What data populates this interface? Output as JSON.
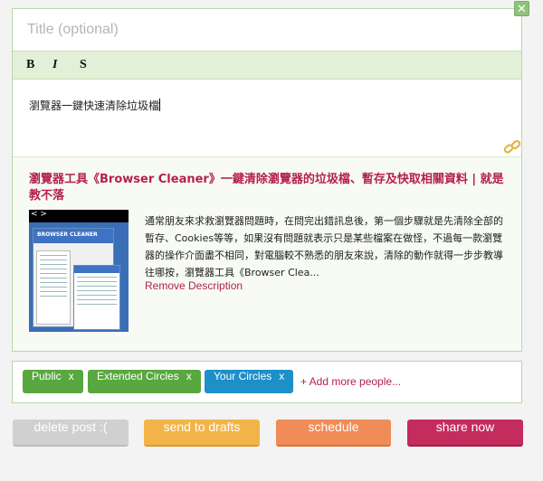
{
  "composer": {
    "close_glyph": "✕",
    "title_placeholder": "Title (optional)",
    "toolbar": {
      "bold": "B",
      "italic": "I",
      "strike": "S"
    },
    "body_text": "瀏覽器一鍵快速清除垃圾檔"
  },
  "preview": {
    "title": "瀏覽器工具《Browser Cleaner》一鍵清除瀏覽器的垃圾檔、暫存及快取相關資料 | 就是教不落",
    "thumbnail": {
      "nav_arrows": "< >",
      "brand": "BROWSER CLEANER"
    },
    "description": "通常朋友來求救瀏覽器問題時，在問完出錯訊息後，第一個步驟就是先清除全部的暫存、Cookies等等，如果沒有問題就表示只是某些檔案在做怪，不過每一款瀏覽器的操作介面盡不相同，對電腦較不熟悉的朋友來說，清除的動作就得一步步教導往哪按，瀏覽器工具《Browser Clea...",
    "remove_label": "Remove Description"
  },
  "circles": {
    "chips": [
      {
        "label": "Public",
        "remove": "x",
        "color": "#58a83f"
      },
      {
        "label": "Extended Circles",
        "remove": "x",
        "color": "#58a83f"
      },
      {
        "label": "Your Circles",
        "remove": "x",
        "color": "#1d8fc9"
      }
    ],
    "add_more": "+ Add more people..."
  },
  "actions": {
    "delete": {
      "label": "delete post :(",
      "color": "#d0d0d0"
    },
    "drafts": {
      "label": "send to drafts",
      "color": "#f2b449"
    },
    "schedule": {
      "label": "schedule",
      "color": "#ef8c57"
    },
    "share": {
      "label": "share now",
      "color": "#c42c5e"
    }
  },
  "colors": {
    "accent": "#b5204f",
    "border": "#b9d7a8",
    "toolbar_bg": "#e3f0d8"
  }
}
